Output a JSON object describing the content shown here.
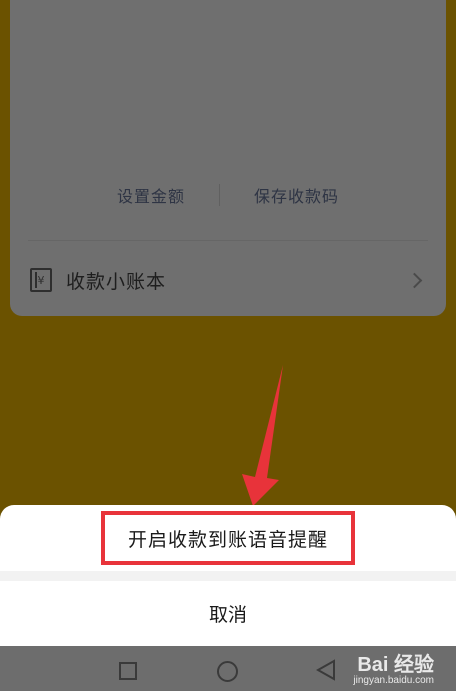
{
  "card": {
    "actions": [
      "设置金额",
      "保存收款码"
    ],
    "ledger": {
      "icon": "ledger-icon",
      "icon_glyph": "¥",
      "label": "收款小账本"
    }
  },
  "sheet": {
    "option_label": "开启收款到账语音提醒",
    "cancel_label": "取消"
  },
  "watermark": {
    "main": "Bai  经验",
    "sub": "jingyan.baidu.com"
  },
  "colors": {
    "background": "#6b5200",
    "annotation": "#e8333a"
  }
}
